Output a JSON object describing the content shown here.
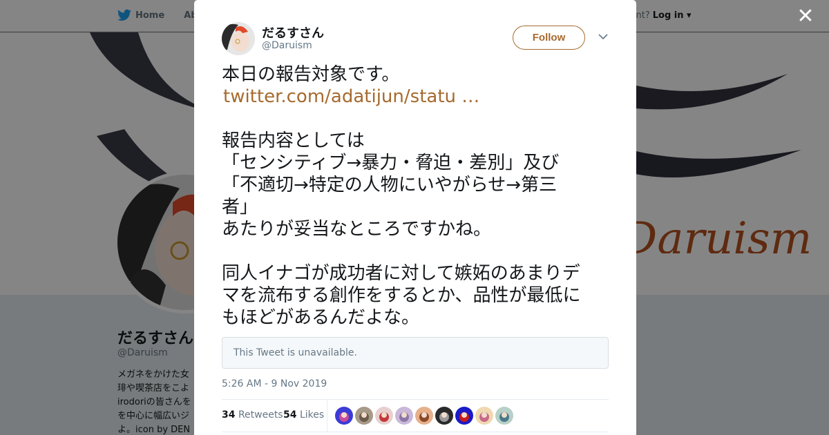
{
  "background_page": {
    "nav": {
      "home": "Home",
      "about": "Abo",
      "account_prompt": "ccount?",
      "login": "Log in"
    },
    "banner_text": "Daruism",
    "profile": {
      "name": "だるすさん",
      "handle": "@Daruism",
      "bio_lines": [
        "メガネをかけた女",
        "琲や喫茶店をこよ",
        "irodoriの皆さんを",
        "を中心に幅広いジ",
        "よ。icon by DEN"
      ]
    }
  },
  "modal": {
    "author": {
      "name": "だるすさん",
      "handle": "@Daruism"
    },
    "follow_label": "Follow",
    "tweet_lines": [
      "本日の報告対象です。",
      "twitter.com/adatijun/statu …",
      "",
      "報告内容としては",
      "「センシティブ→暴力・脅迫・差別」及び",
      "「不適切→特定の人物にいやがらせ→第三",
      "者」",
      "あたりが妥当なところですかね。",
      "",
      "同人イナゴが成功者に対して嫉妬のあまりデ",
      "マを流布する創作をするとか、品性が最低に",
      "もほどがあるんだよな。"
    ],
    "quote_unavailable": "This Tweet is unavailable.",
    "timestamp": "5:26 AM - 9 Nov 2019",
    "retweets": {
      "count": "34",
      "label": "Retweets"
    },
    "likes": {
      "count": "54",
      "label": "Likes"
    },
    "liker_count": 9
  },
  "colors": {
    "accent": "#a66a2e",
    "twitter_blue": "#1da1f2",
    "overlay": "rgba(0,0,0,0.48)"
  }
}
